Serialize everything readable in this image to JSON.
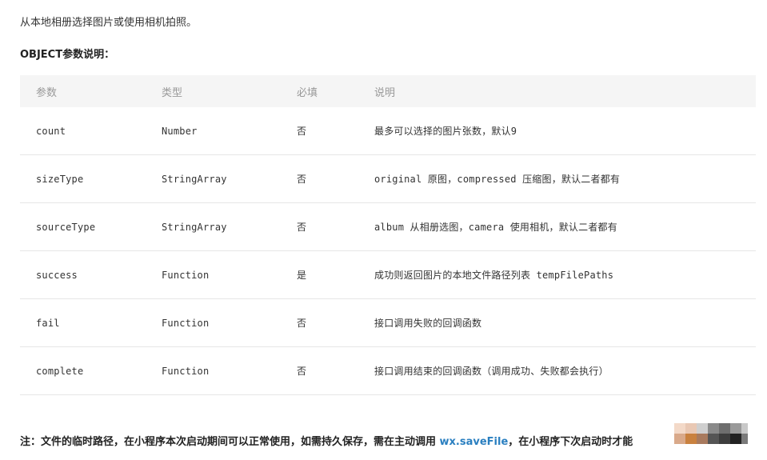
{
  "intro": "从本地相册选择图片或使用相机拍照。",
  "heading": "OBJECT参数说明：",
  "table": {
    "headers": [
      "参数",
      "类型",
      "必填",
      "说明"
    ],
    "rows": [
      {
        "name": "count",
        "type": "Number",
        "required": "否",
        "desc": "最多可以选择的图片张数，默认9"
      },
      {
        "name": "sizeType",
        "type": "StringArray",
        "required": "否",
        "desc": "original 原图，compressed 压缩图，默认二者都有"
      },
      {
        "name": "sourceType",
        "type": "StringArray",
        "required": "否",
        "desc": "album 从相册选图，camera 使用相机，默认二者都有"
      },
      {
        "name": "success",
        "type": "Function",
        "required": "是",
        "desc": "成功则返回图片的本地文件路径列表 tempFilePaths"
      },
      {
        "name": "fail",
        "type": "Function",
        "required": "否",
        "desc": "接口调用失败的回调函数"
      },
      {
        "name": "complete",
        "type": "Function",
        "required": "否",
        "desc": "接口调用结束的回调函数（调用成功、失败都会执行）"
      }
    ]
  },
  "note": {
    "prefix": "注：文件的临时路径，在小程序本次启动期间可以正常使用，如需持久保存，需在主动调用 ",
    "link": "wx.saveFile",
    "suffix": "，在小程序下次启动时才能"
  },
  "colors": {
    "header_bg": "#f5f5f5",
    "header_text": "#999999",
    "row_border": "#e6e6e6",
    "link": "#2a7fc0"
  }
}
